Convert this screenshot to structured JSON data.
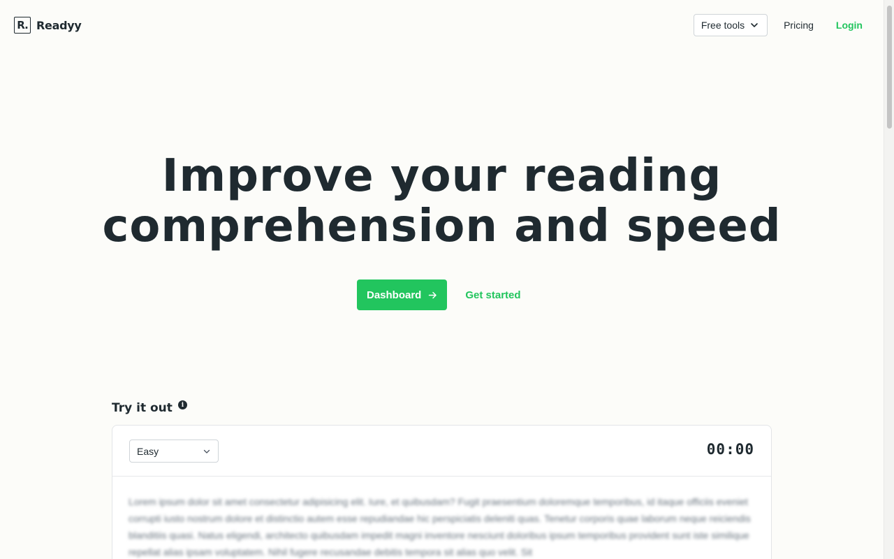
{
  "header": {
    "logo_mark": "R.",
    "brand": "Readyy",
    "free_tools_label": "Free tools",
    "pricing_label": "Pricing",
    "login_label": "Login"
  },
  "hero": {
    "title_line1": "Improve your reading",
    "title_line2": "comprehension and speed",
    "dashboard_label": "Dashboard",
    "get_started_label": "Get started"
  },
  "try": {
    "heading": "Try it out",
    "difficulty": "Easy",
    "timer": "00:00",
    "passage": "Lorem ipsum dolor sit amet consectetur adipisicing elit. Iure, et quibusdam? Fugit praesentium doloremque temporibus, id itaque officiis eveniet corrupti iusto nostrum dolore et distinctio autem esse repudiandae hic perspiciatis deleniti quas. Tenetur corporis quae laborum neque reiciendis blanditiis quasi. Natus eligendi, architecto quibusdam impedit magni inventore nesciunt doloribus ipsum temporibus provident sunt iste similique repellat alias ipsam voluptatem. Nihil fugere recusandae debitis tempora sit alias quo velit. Sit"
  },
  "colors": {
    "accent": "#22c55e",
    "text": "#1f2a30",
    "background": "#fcfcf9"
  }
}
